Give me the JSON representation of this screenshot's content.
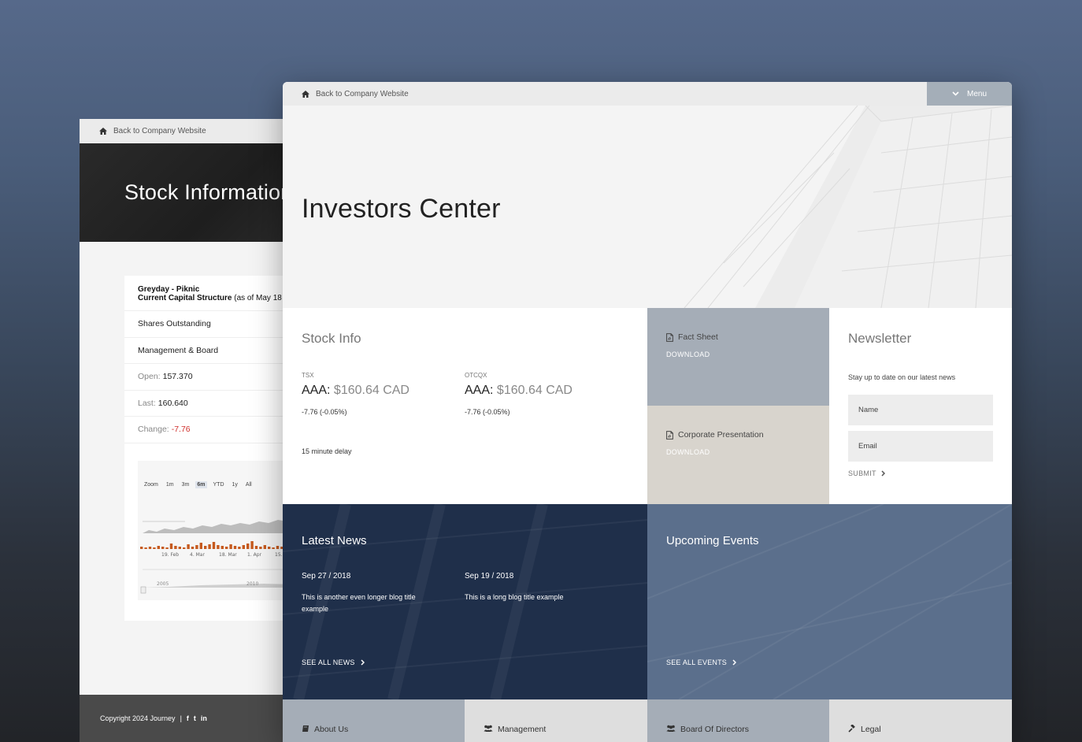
{
  "back_window": {
    "back_link": "Back to Company Website",
    "hero_title": "Stock Information",
    "capital": {
      "company": "Greyday - Piknic",
      "structure_bold": "Current Capital Structure",
      "structure_note": "(as of May 18"
    },
    "rows": {
      "shares": "Shares Outstanding",
      "mgmt": "Management & Board",
      "open_label": "Open:",
      "open_value": "157.370",
      "last_label": "Last:",
      "last_value": "160.640",
      "change_label": "Change:",
      "change_value": "-7.76"
    },
    "chart": {
      "zoom_label": "Zoom",
      "zoom_options": [
        "1m",
        "3m",
        "6m",
        "YTD",
        "1y",
        "All"
      ],
      "zoom_active": "6m",
      "dates": [
        "19. Feb",
        "4. Mar",
        "18. Mar",
        "1. Apr",
        "15."
      ],
      "nav_years": [
        "2005",
        "2010"
      ],
      "accent": "#c65a1e"
    },
    "footer": {
      "copyright": "Copyright 2024 Journey",
      "separator": "|",
      "social": [
        "f",
        "t",
        "in"
      ]
    }
  },
  "front_window": {
    "back_link": "Back to Company Website",
    "menu_label": "Menu",
    "hero_title": "Investors Center",
    "stock": {
      "title": "Stock Info",
      "quotes": [
        {
          "exchange": "TSX",
          "symbol": "AAA:",
          "price": "$160.64 CAD",
          "change": "-7.76 (-0.05%)"
        },
        {
          "exchange": "OTCQX",
          "symbol": "AAA:",
          "price": "$160.64 CAD",
          "change": "-7.76 (-0.05%)"
        }
      ],
      "delay": "15 minute delay"
    },
    "downloads": [
      {
        "title": "Fact Sheet",
        "link": "DOWNLOAD",
        "icon": "file-pdf-icon",
        "color": "#a5adb7"
      },
      {
        "title": "Corporate Presentation",
        "link": "DOWNLOAD",
        "icon": "file-pdf-icon",
        "color": "#d8d4cd"
      }
    ],
    "newsletter": {
      "title": "Newsletter",
      "desc": "Stay up to date on our latest news",
      "name_placeholder": "Name",
      "email_placeholder": "Email",
      "submit": "SUBMIT"
    },
    "latest_news": {
      "title": "Latest News",
      "items": [
        {
          "date": "Sep 27 / 2018",
          "text": "This is another even longer blog title example"
        },
        {
          "date": "Sep 19 / 2018",
          "text": "This is a long blog title example"
        }
      ],
      "see_all": "SEE ALL NEWS",
      "color": "#1f2f4a"
    },
    "upcoming_events": {
      "title": "Upcoming Events",
      "see_all": "SEE ALL EVENTS",
      "color": "#5b6f8c"
    },
    "footer_tiles": [
      {
        "label": "About Us",
        "icon": "book-icon"
      },
      {
        "label": "Management",
        "icon": "users-icon"
      },
      {
        "label": "Board Of Directors",
        "icon": "users-icon"
      },
      {
        "label": "Legal",
        "icon": "gavel-icon"
      }
    ]
  }
}
